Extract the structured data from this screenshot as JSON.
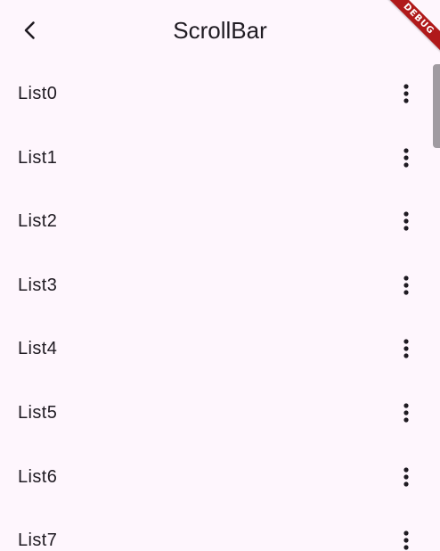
{
  "app_bar": {
    "title": "ScrollBar",
    "back_icon": "chevron-left-icon"
  },
  "list": {
    "items": [
      {
        "label": "List0",
        "action_icon": "more-vert-icon"
      },
      {
        "label": "List1",
        "action_icon": "more-vert-icon"
      },
      {
        "label": "List2",
        "action_icon": "more-vert-icon"
      },
      {
        "label": "List3",
        "action_icon": "more-vert-icon"
      },
      {
        "label": "List4",
        "action_icon": "more-vert-icon"
      },
      {
        "label": "List5",
        "action_icon": "more-vert-icon"
      },
      {
        "label": "List6",
        "action_icon": "more-vert-icon"
      },
      {
        "label": "List7",
        "action_icon": "more-vert-icon"
      }
    ]
  },
  "debug_banner": {
    "label": "DEBUG",
    "color": "#b0191a"
  },
  "colors": {
    "background": "#FEF6FD",
    "text": "#1f1b22",
    "scrollbar": "#8f8b91"
  }
}
